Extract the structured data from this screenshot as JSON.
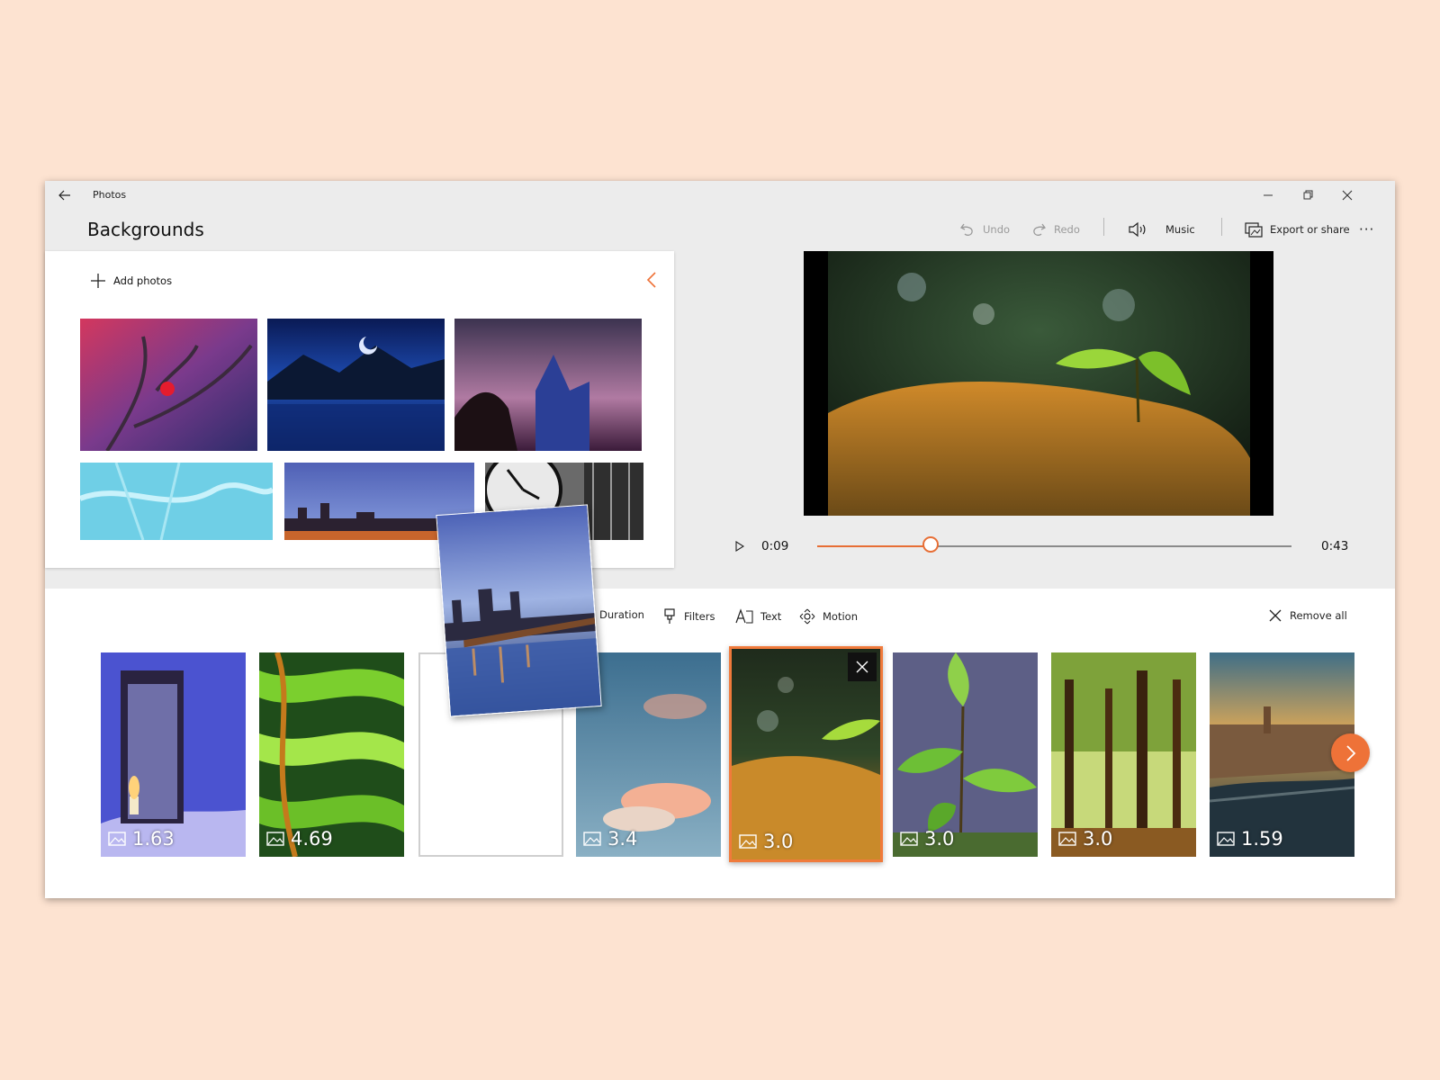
{
  "app": {
    "title": "Photos",
    "page_title": "Backgrounds"
  },
  "toolbar": {
    "undo_label": "Undo",
    "redo_label": "Redo",
    "music_label": "Music",
    "export_label": "Export or share",
    "more_label": "···"
  },
  "library": {
    "add_photos_label": "Add photos",
    "photos": [
      "red-berry-branch",
      "moonlit-mountain-lake",
      "castle-at-dusk",
      "frosted-ice-pattern",
      "city-skyline-panorama",
      "clock-tower-face"
    ]
  },
  "player": {
    "current_time": "0:09",
    "total_time": "0:43",
    "progress": 0.24
  },
  "storyboard": {
    "duration_label": "Duration",
    "filters_label": "Filters",
    "text_label": "Text",
    "motion_label": "Motion",
    "remove_all_label": "Remove all",
    "cards": [
      {
        "subject": "candle-lantern",
        "duration": "1.63"
      },
      {
        "subject": "green-abstract",
        "duration": "4.69"
      },
      {
        "subject": "cloud-sky",
        "duration": "3.4"
      },
      {
        "subject": "seedling-moss",
        "duration": "3.0"
      },
      {
        "subject": "green-leaves",
        "duration": "3.0"
      },
      {
        "subject": "forest-trees",
        "duration": "3.0"
      },
      {
        "subject": "city-aerial",
        "duration": "1.59"
      }
    ]
  },
  "colors": {
    "accent": "#ee7238",
    "background": "#fde3d1"
  }
}
